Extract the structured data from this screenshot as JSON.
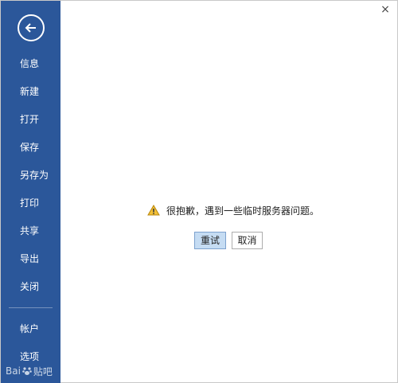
{
  "sidebar": {
    "back_icon": "back-arrow-icon",
    "items": [
      {
        "label": "信息"
      },
      {
        "label": "新建"
      },
      {
        "label": "打开"
      },
      {
        "label": "保存"
      },
      {
        "label": "另存为"
      },
      {
        "label": "打印"
      },
      {
        "label": "共享"
      },
      {
        "label": "导出"
      },
      {
        "label": "关闭"
      }
    ],
    "bottom_items": [
      {
        "label": "帐户"
      },
      {
        "label": "选项"
      }
    ],
    "background_color": "#2b579a"
  },
  "window": {
    "close_label": "×"
  },
  "dialog": {
    "icon": "warning-icon",
    "message": "很抱歉，遇到一些临时服务器问题。",
    "retry_label": "重试",
    "cancel_label": "取消"
  },
  "watermark": {
    "text_left": "Bai",
    "text_right": "贴吧"
  }
}
